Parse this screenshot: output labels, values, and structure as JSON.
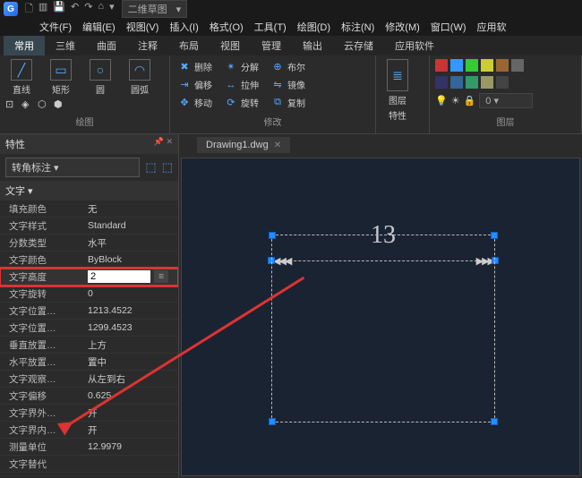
{
  "app": {
    "view_dropdown": "二维草图"
  },
  "menus": [
    "文件(F)",
    "编辑(E)",
    "视图(V)",
    "插入(I)",
    "格式(O)",
    "工具(T)",
    "绘图(D)",
    "标注(N)",
    "修改(M)",
    "窗口(W)",
    "应用软"
  ],
  "tabs": [
    "常用",
    "三维",
    "曲面",
    "注释",
    "布局",
    "视图",
    "管理",
    "输出",
    "云存储",
    "应用软件"
  ],
  "ribbon": {
    "draw": {
      "label": "绘图",
      "line": "直线",
      "rect": "矩形",
      "circle": "圆",
      "arc": "圆弧"
    },
    "modify": {
      "label": "修改",
      "delete": "删除",
      "explode": "分解",
      "boolean": "布尔",
      "offset": "偏移",
      "stretch": "拉伸",
      "mirror": "镜像",
      "move": "移动",
      "rotate": "旋转",
      "copy": "复制"
    },
    "layer": {
      "label": "图层",
      "props": "图层",
      "props2": "特性"
    }
  },
  "panel": {
    "title": "特性",
    "type_select": "转角标注",
    "section": "文字",
    "rows": [
      {
        "k": "填充颜色",
        "v": "无"
      },
      {
        "k": "文字样式",
        "v": "Standard"
      },
      {
        "k": "分数类型",
        "v": "水平"
      },
      {
        "k": "文字颜色",
        "v": "ByBlock"
      },
      {
        "k": "文字高度",
        "v": "2",
        "highlight": true
      },
      {
        "k": "文字旋转",
        "v": "0"
      },
      {
        "k": "文字位置…",
        "v": "1213.4522"
      },
      {
        "k": "文字位置…",
        "v": "1299.4523"
      },
      {
        "k": "垂直放置…",
        "v": "上方"
      },
      {
        "k": "水平放置…",
        "v": "置中"
      },
      {
        "k": "文字观察…",
        "v": "从左到右"
      },
      {
        "k": "文字偏移",
        "v": "0.625"
      },
      {
        "k": "文字界外…",
        "v": "开"
      },
      {
        "k": "文字界内…",
        "v": "开"
      },
      {
        "k": "测量单位",
        "v": "12.9979"
      },
      {
        "k": "文字替代",
        "v": ""
      }
    ]
  },
  "file": {
    "name": "Drawing1.dwg"
  },
  "dimension": {
    "value": "13"
  }
}
